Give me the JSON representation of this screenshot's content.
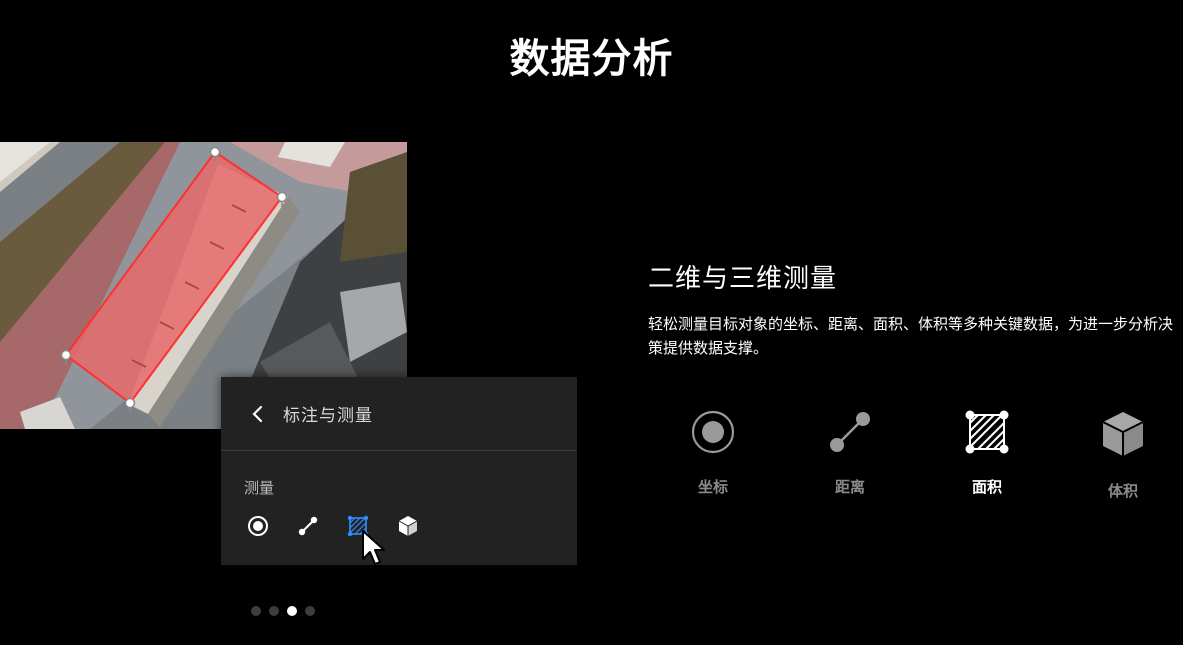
{
  "page": {
    "title": "数据分析"
  },
  "panel": {
    "title": "标注与测量",
    "section_label": "测量",
    "tools": [
      {
        "name": "coordinate",
        "icon": "target-icon"
      },
      {
        "name": "distance",
        "icon": "line-icon"
      },
      {
        "name": "area",
        "icon": "polygon-icon",
        "active": true
      },
      {
        "name": "volume",
        "icon": "cube-icon"
      }
    ]
  },
  "feature": {
    "title": "二维与三维测量",
    "description": "轻松测量目标对象的坐标、距离、面积、体积等多种关键数据，为进一步分析决策提供数据支撑。",
    "items": [
      {
        "label": "坐标",
        "icon": "target-icon"
      },
      {
        "label": "距离",
        "icon": "line-icon"
      },
      {
        "label": "面积",
        "icon": "polygon-icon",
        "active": true
      },
      {
        "label": "体积",
        "icon": "cube-icon"
      }
    ]
  },
  "carousel": {
    "pages": 4,
    "current": 3
  },
  "colors": {
    "accent": "#2f8fff",
    "highlight": "#e06060",
    "background": "#000000",
    "panel": "#222222"
  }
}
